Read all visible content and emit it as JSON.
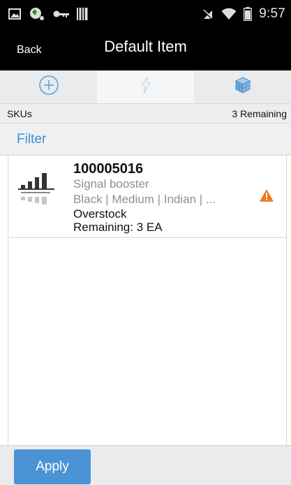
{
  "status_bar": {
    "time": "9:57",
    "icons_left": [
      "image-icon",
      "map-icon",
      "key-icon",
      "barcode-icon"
    ],
    "icons_right": [
      "signal-off-icon",
      "wifi-icon",
      "battery-icon"
    ]
  },
  "header": {
    "back_label": "Back",
    "title": "Default Item"
  },
  "tabs": [
    {
      "icon": "add-circle-icon",
      "active": false
    },
    {
      "icon": "lightning-icon",
      "active": true
    },
    {
      "icon": "cube-icon",
      "active": false
    }
  ],
  "sku_bar": {
    "label": "SKUs",
    "remaining": "3 Remaining"
  },
  "filter": {
    "label": "Filter"
  },
  "items": [
    {
      "id": "100005016",
      "description": "Signal booster",
      "attributes": "Black | Medium | Indian | ...",
      "location": "Overstock",
      "remaining": "Remaining: 3 EA",
      "thumbnail_icon": "signal-booster-icon",
      "status_icon": "warning-icon"
    }
  ],
  "footer": {
    "apply_label": "Apply"
  },
  "colors": {
    "accent": "#4c93d6",
    "link": "#3e8fd4",
    "warning": "#f07a1a",
    "bar_bg": "#000000"
  }
}
